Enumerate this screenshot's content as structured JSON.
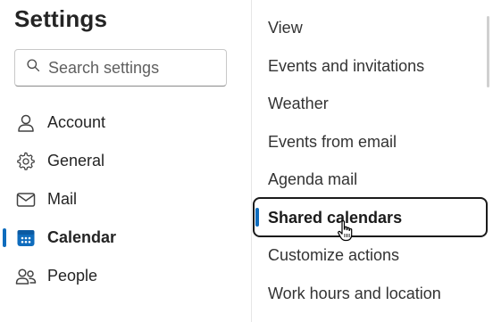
{
  "title": "Settings",
  "search": {
    "placeholder": "Search settings",
    "icon": "search-icon"
  },
  "nav": {
    "items": [
      {
        "label": "Account",
        "icon": "person-icon",
        "active": false
      },
      {
        "label": "General",
        "icon": "gear-icon",
        "active": false
      },
      {
        "label": "Mail",
        "icon": "mail-icon",
        "active": false
      },
      {
        "label": "Calendar",
        "icon": "calendar-icon",
        "active": true
      },
      {
        "label": "People",
        "icon": "people-icon",
        "active": false
      }
    ]
  },
  "calendar_sections": {
    "items": [
      "View",
      "Events and invitations",
      "Weather",
      "Events from email",
      "Agenda mail",
      "Shared calendars",
      "Customize actions",
      "Work hours and location"
    ],
    "selected": "Shared calendars"
  },
  "colors": {
    "accent": "#0f6cbd",
    "text": "#242424",
    "calendar_icon": "#0f6cbd"
  }
}
